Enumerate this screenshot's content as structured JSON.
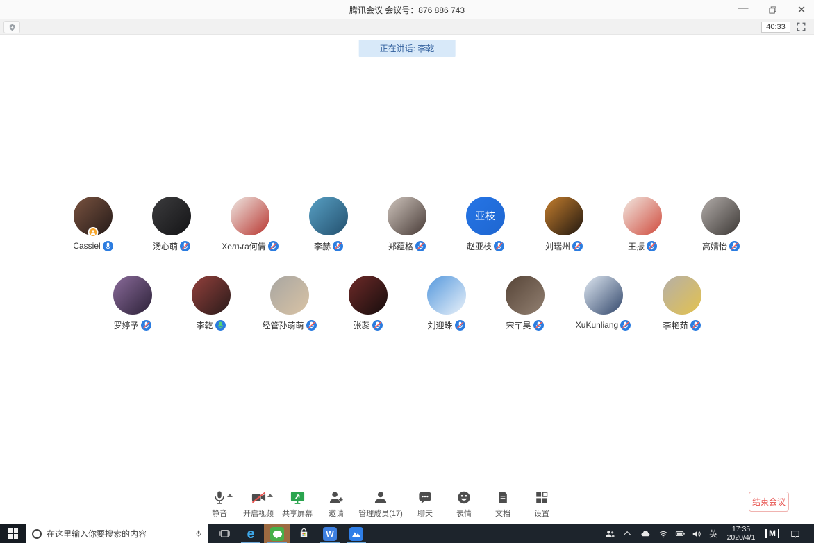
{
  "window": {
    "title": "腾讯会议 会议号：876 886 743",
    "timer": "40:33",
    "speaking_banner": "正在讲话: 李乾"
  },
  "icons": {
    "shield": "security-shield",
    "fullscreen": "expand-corners",
    "minimize": "—",
    "restore": "overlapping-squares",
    "close": "✕",
    "caret_up": "▲",
    "mic_on_color": "#ffffff",
    "mic_speaking_color": "#56d273",
    "mic_muted_slash_color": "#ff5f56",
    "mic_badge_color": "#2b7ce0",
    "host_badge_color": "#f6a62d"
  },
  "participants": {
    "row1": [
      {
        "name": "Cassiel",
        "mic": "on",
        "host": true,
        "colors": [
          "#7a5340",
          "#241a18"
        ]
      },
      {
        "name": "汤心萌",
        "mic": "muted",
        "colors": [
          "#3c3c3e",
          "#141416"
        ]
      },
      {
        "name": "Хелъга何倩",
        "mic": "muted",
        "colors": [
          "#efe9e4",
          "#b8352f"
        ]
      },
      {
        "name": "李赫",
        "mic": "muted",
        "colors": [
          "#58a0c4",
          "#23506e"
        ]
      },
      {
        "name": "郑蕴格",
        "mic": "muted",
        "colors": [
          "#cfc5bd",
          "#473a36"
        ]
      },
      {
        "name": "赵亚枝",
        "mic": "muted",
        "avatar_text": "亚枝",
        "colors": [
          "#2575e6",
          "#1f66d0"
        ]
      },
      {
        "name": "刘瑞州",
        "mic": "muted",
        "colors": [
          "#c67f2e",
          "#201710"
        ]
      },
      {
        "name": "王振",
        "mic": "muted",
        "colors": [
          "#f2e9e2",
          "#cf4a3c"
        ]
      },
      {
        "name": "高婧怡",
        "mic": "muted",
        "colors": [
          "#b3adaa",
          "#3b3734"
        ]
      }
    ],
    "row2": [
      {
        "name": "罗婷予",
        "mic": "muted",
        "colors": [
          "#8a6b9a",
          "#2c2138"
        ]
      },
      {
        "name": "李乾",
        "mic": "speaking",
        "colors": [
          "#93403c",
          "#2a1b1a"
        ]
      },
      {
        "name": "经管孙萌萌",
        "mic": "muted",
        "colors": [
          "#a8a6a2",
          "#d9c3a4"
        ]
      },
      {
        "name": "张蕊",
        "mic": "muted",
        "colors": [
          "#6e2a28",
          "#160d0d"
        ]
      },
      {
        "name": "刘迎珠",
        "mic": "muted",
        "colors": [
          "#5598dd",
          "#e9f1f9"
        ]
      },
      {
        "name": "宋芊昊",
        "mic": "muted",
        "colors": [
          "#564437",
          "#928071"
        ]
      },
      {
        "name": "XuKunliang",
        "mic": "muted",
        "colors": [
          "#dfe8f2",
          "#32476b"
        ]
      },
      {
        "name": "李艳茹",
        "mic": "muted",
        "colors": [
          "#b5afa8",
          "#e3c24e"
        ]
      }
    ]
  },
  "toolbar": {
    "items": [
      {
        "label": "静音"
      },
      {
        "label": "开启视频"
      },
      {
        "label": "共享屏幕"
      },
      {
        "label": "邀请"
      },
      {
        "label": "管理成员(17)"
      },
      {
        "label": "聊天"
      },
      {
        "label": "表情"
      },
      {
        "label": "文档"
      },
      {
        "label": "设置"
      }
    ],
    "end_button": "结束会议",
    "share_green": "#2aa44e",
    "camera_slash_red": "#e85450"
  },
  "taskbar": {
    "search_placeholder": "在这里输入你要搜索的内容",
    "w7_label": "W",
    "tray": {
      "ime": "英",
      "time": "17:35",
      "date": "2020/4/1",
      "meeting_logo": "M"
    }
  }
}
